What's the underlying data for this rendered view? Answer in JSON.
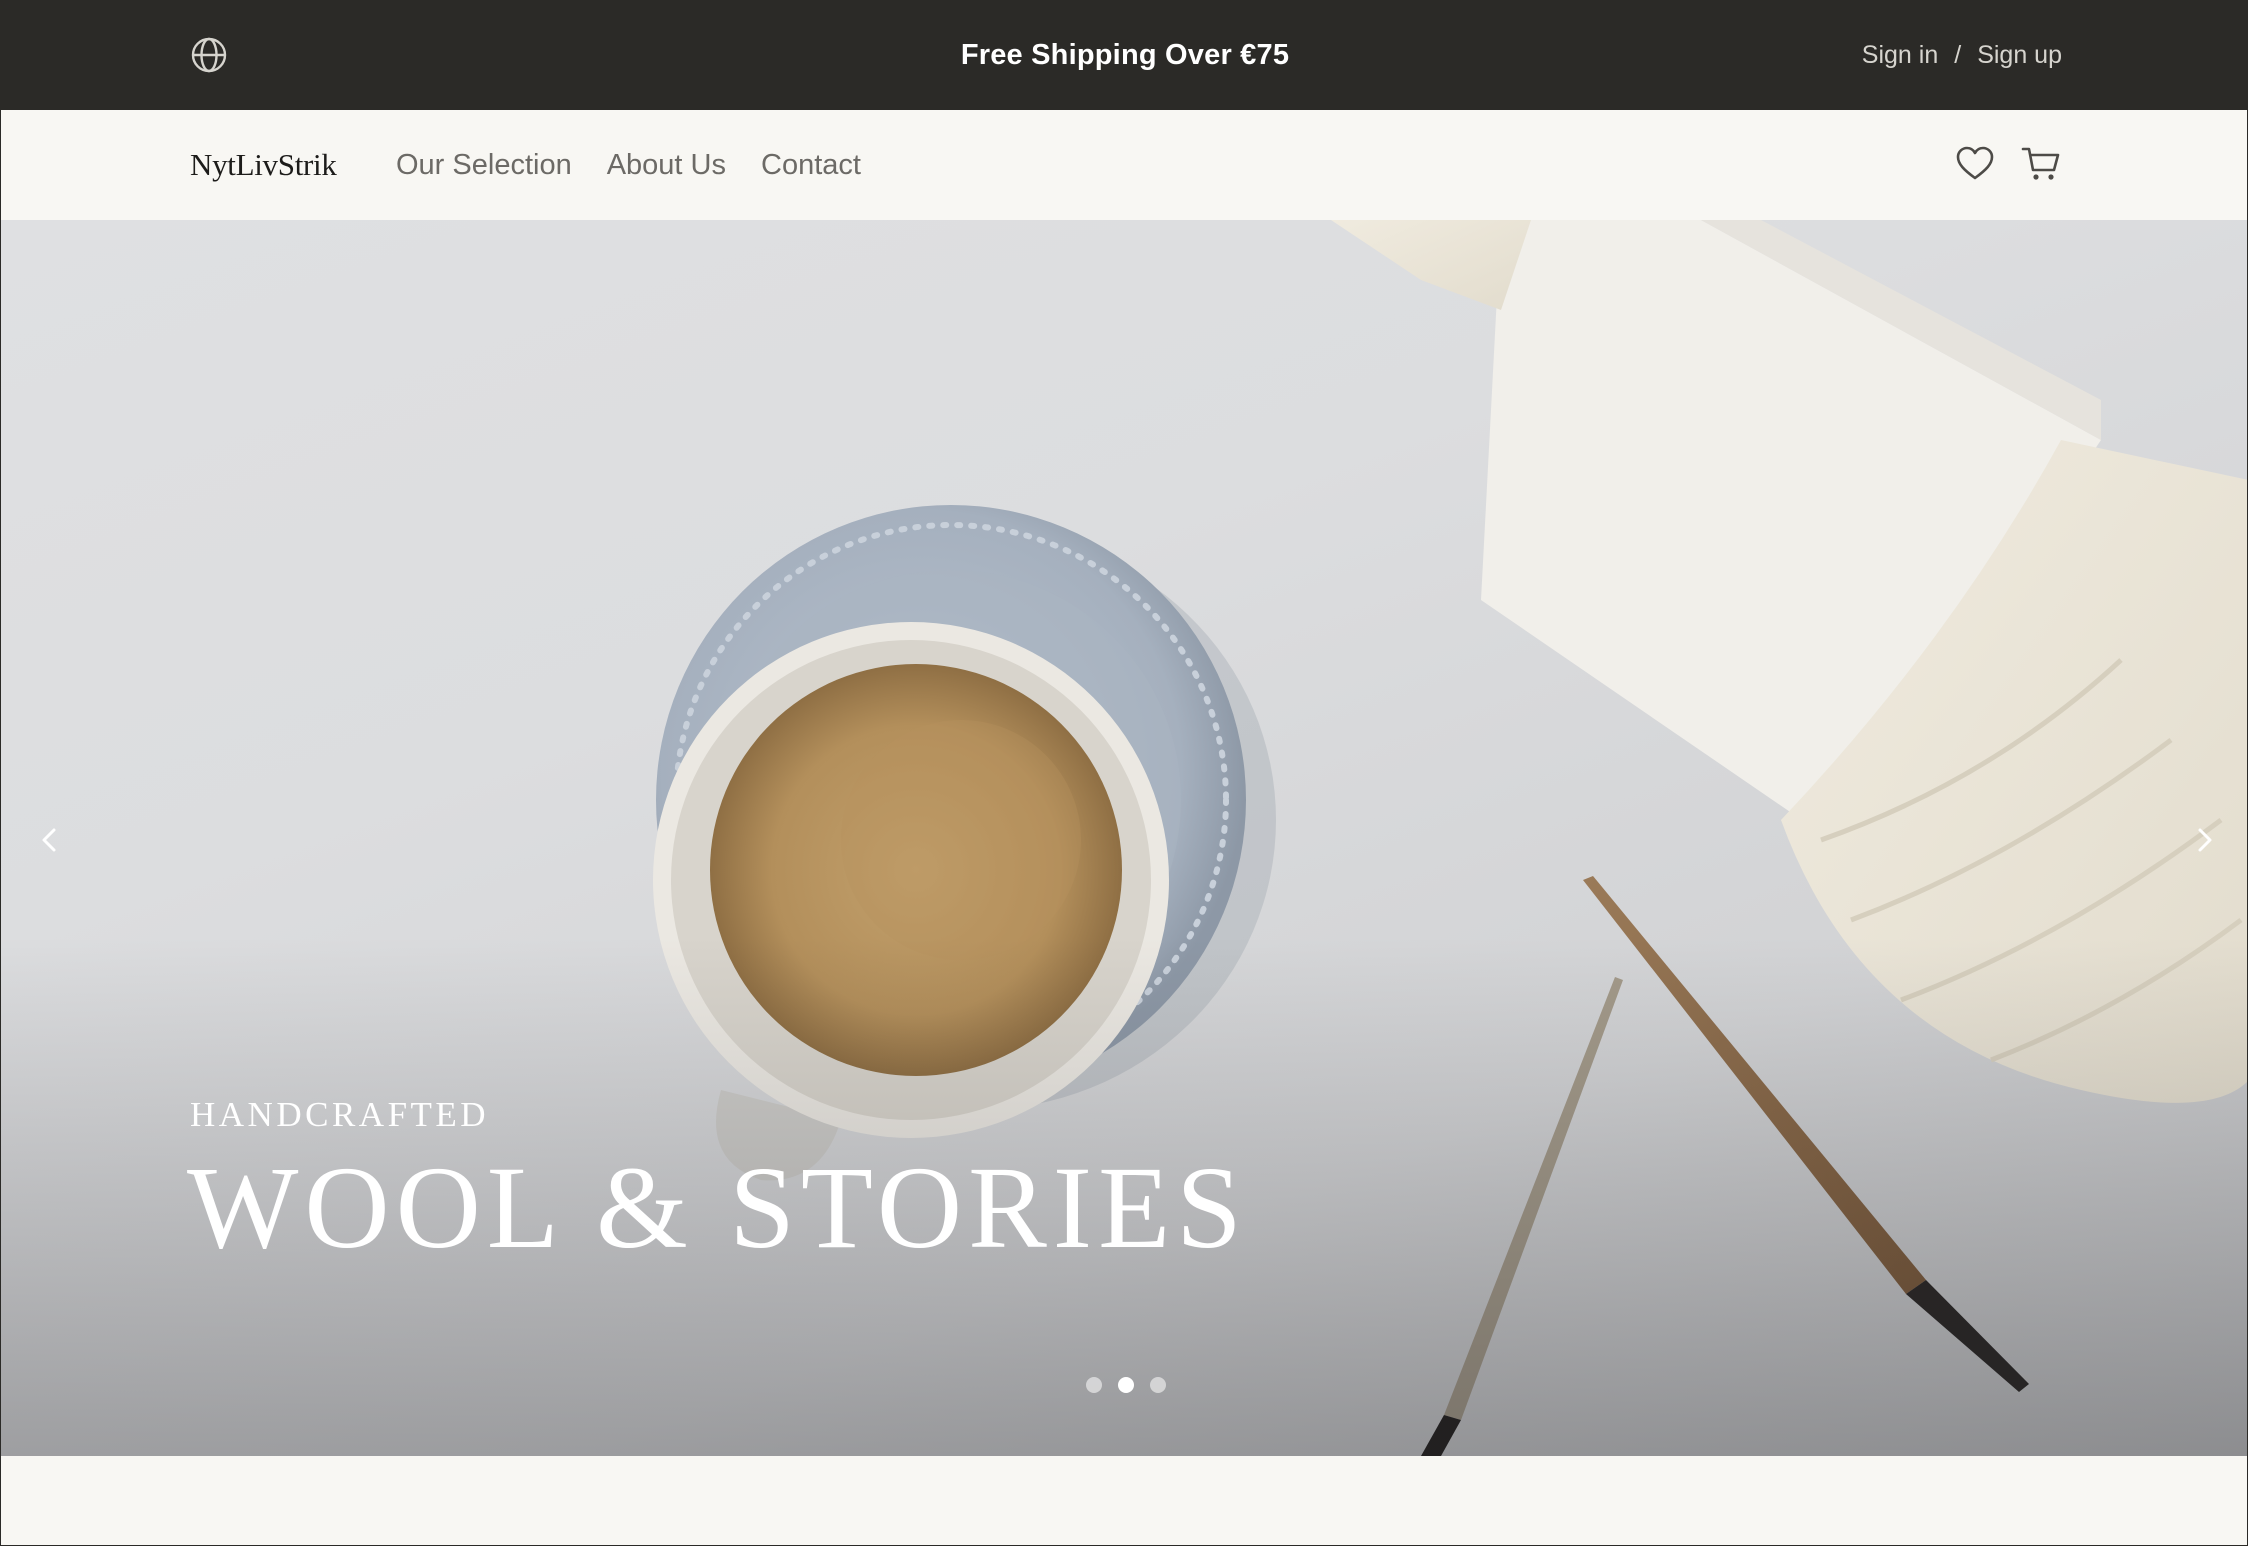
{
  "announcement": {
    "text": "Free Shipping Over €75",
    "sign_in": "Sign in",
    "separator": "/",
    "sign_up": "Sign up"
  },
  "header": {
    "logo": "NytLivStrik",
    "nav": [
      "Our Selection",
      "About Us",
      "Contact"
    ]
  },
  "hero": {
    "eyebrow": "HANDCRAFTED",
    "headline": "WOOL & STORIES",
    "slides": {
      "count": 3,
      "active_index": 1
    }
  },
  "icons": [
    "globe-icon",
    "heart-icon",
    "cart-icon",
    "chevron-left-icon",
    "chevron-right-icon"
  ],
  "colors": {
    "topbar_bg": "#2b2a27",
    "page_bg": "#f8f7f3",
    "nav_text": "#6c6a66",
    "hero_text": "#ffffff"
  }
}
